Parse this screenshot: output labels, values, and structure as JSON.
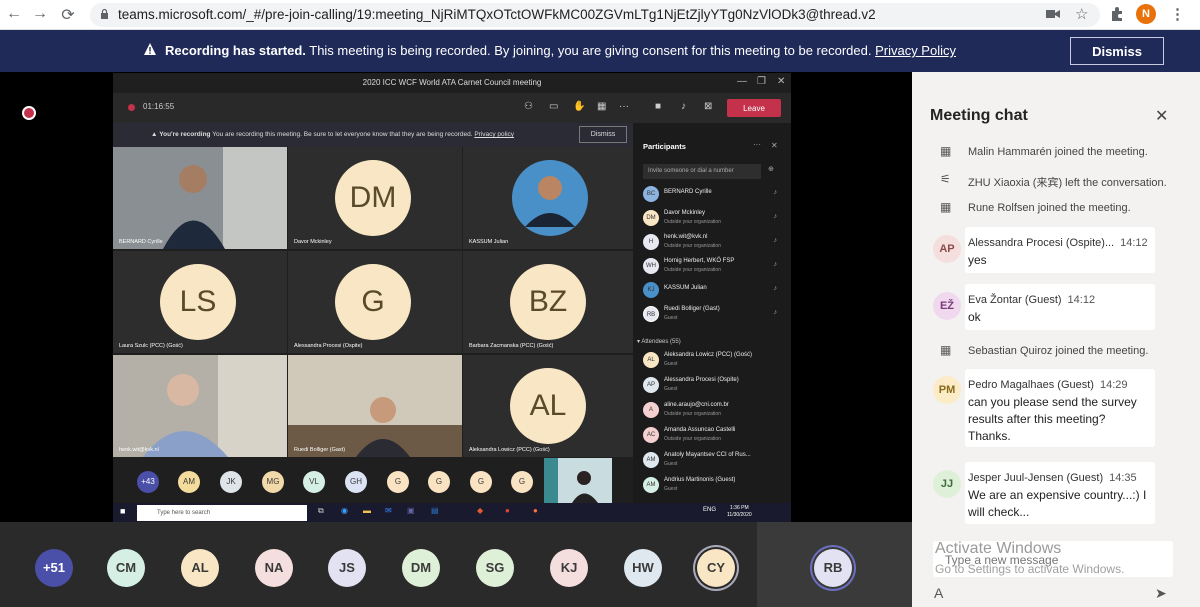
{
  "browser": {
    "url": "teams.microsoft.com/_#/pre-join-calling/19:meeting_NjRiMTQxOTctOWFkMC00ZGVmLTg1NjEtZjlyYTg0NzVlODk3@thread.v2",
    "back_icon": "←",
    "forward_icon": "→",
    "reload_icon": "⟳",
    "profile_initial": "N",
    "menu_icon": "⋮"
  },
  "banner": {
    "title": "Recording has started.",
    "message": " This meeting is being recorded. By joining, you are giving consent for this meeting to be recorded. ",
    "link": "Privacy Policy",
    "dismiss": "Dismiss"
  },
  "inner": {
    "window_title": "2020 ICC WCF World ATA Carnet Council meeting",
    "timer": "01:16:55",
    "leave": "Leave",
    "rec_title": "You're recording",
    "rec_msg": " You are recording this meeting. Be sure to let everyone know that they are being recorded. ",
    "rec_link": "Privacy policy",
    "rec_dismiss": "Dismiss",
    "tiles": [
      {
        "name": "BERNARD Cyrille"
      },
      {
        "name": "Davor Mckinley",
        "initials": "DM"
      },
      {
        "name": "KASSUM Julian"
      },
      {
        "name": "Laura Szulc (PCC) (Gość)",
        "initials": "LS"
      },
      {
        "name": "Alessandra Procesi (Ospite)",
        "initials": "G"
      },
      {
        "name": "Barbara Zacmanska (PCC) (Gość)",
        "initials": "BZ"
      },
      {
        "name": "henk.wit@kvk.nl"
      },
      {
        "name": "Ruedi Bolliger (Gast)"
      },
      {
        "name": "Aleksandra Lowicz (PCC) (Gość)",
        "initials": "AL"
      }
    ],
    "strip": [
      "+43",
      "AM",
      "JK",
      "MG",
      "VL",
      "GH",
      "G",
      "G",
      "G",
      "G"
    ],
    "participants_title": "Participants",
    "invite_placeholder": "Invite someone or dial a number",
    "participants": [
      {
        "initials": "BC",
        "name": "BERNARD Cyrille",
        "sub": ""
      },
      {
        "initials": "DM",
        "name": "Davor Mckinley",
        "sub": "Outside your organization"
      },
      {
        "initials": "H",
        "name": "henk.wit@kvk.nl",
        "sub": "Outside your organization"
      },
      {
        "initials": "WH",
        "name": "Hornig Herbert, WKÖ FSP",
        "sub": "Outside your organization"
      },
      {
        "initials": "KJ",
        "name": "KASSUM Julian",
        "sub": ""
      },
      {
        "initials": "RB",
        "name": "Ruedi Bolliger (Gast)",
        "sub": "Guest"
      }
    ],
    "attendees_header": "▾  Attendees (55)",
    "attendees": [
      {
        "initials": "AL",
        "name": "Aleksandra Lowicz (PCC) (Gość)",
        "sub": "Guest"
      },
      {
        "initials": "AP",
        "name": "Alessandra Procesi (Ospite)",
        "sub": "Guest"
      },
      {
        "initials": "A",
        "name": "aline.araujo@cni.com.br",
        "sub": "Outside your organization"
      },
      {
        "initials": "AC",
        "name": "Amanda Assuncao Castelli",
        "sub": "Outside your organization"
      },
      {
        "initials": "AM",
        "name": "Anatoly Mayantsev CCI of Rus...",
        "sub": "Guest"
      },
      {
        "initials": "AM",
        "name": "Andrius Martinonis (Guest)",
        "sub": "Guest"
      }
    ],
    "taskbar_search": "Type here to search",
    "clock_time": "1:36 PM",
    "clock_date": "11/30/2020",
    "lang": "ENG"
  },
  "bottom_avatars": [
    "+51",
    "CM",
    "AL",
    "NA",
    "JS",
    "DM",
    "SG",
    "KJ",
    "HW",
    "CY",
    "RB"
  ],
  "chat": {
    "title": "Meeting chat",
    "close_icon": "✕",
    "events": [
      {
        "icon": "join-icon",
        "text": "Malin Hammarén joined the meeting."
      },
      {
        "icon": "leave-icon",
        "text": "ZHU Xiaoxia (来宾) left the conversation."
      },
      {
        "icon": "join-icon",
        "text": "Rune Rolfsen joined the meeting."
      },
      {
        "icon": "join-icon",
        "text": "Sebastian Quiroz joined the meeting."
      }
    ],
    "messages": [
      {
        "initials": "AP",
        "author": "Alessandra Procesi (Ospite)...",
        "time": "14:12",
        "text": "yes"
      },
      {
        "initials": "EŽ",
        "author": "Eva Žontar (Guest)",
        "time": "14:12",
        "text": "ok"
      },
      {
        "initials": "PM",
        "author": "Pedro Magalhaes (Guest)",
        "time": "14:29",
        "text": "can you please send the survey results after this meeting? Thanks."
      },
      {
        "initials": "JJ",
        "author": "Jesper Juul-Jensen (Guest)",
        "time": "14:35",
        "text": "We are an expensive country...:) I will check..."
      }
    ],
    "compose_placeholder": "Type a new message",
    "watermark_title": "Activate Windows",
    "watermark_sub": "Go to Settings to activate Windows.",
    "format_icon": "A",
    "send_icon": "➤"
  }
}
